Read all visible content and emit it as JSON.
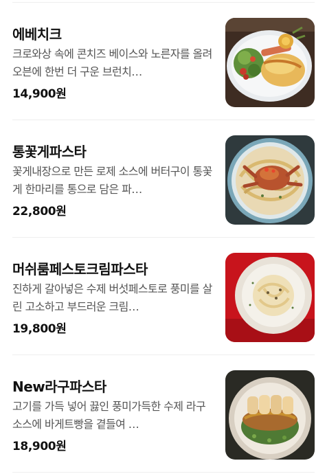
{
  "menu": {
    "items": [
      {
        "name": "에베치크",
        "description": "크로와상 속에 콘치즈 베이스와 노른자를 올려 오븐에 한번 더 구운 브런치…",
        "price": "14,900원",
        "image_icon": "brunch-plate-image"
      },
      {
        "name": "통꽃게파스타",
        "description": "꽃게내장으로 만든 로제 소스에 버터구이 통꽃게 한마리를 통으로 담은 파…",
        "price": "22,800원",
        "image_icon": "crab-pasta-image"
      },
      {
        "name": "머쉬룸페스토크림파스타",
        "description": "진하게 갈아넣은 수제 버섯페스토로 풍미를 살린 고소하고 부드러운 크림…",
        "price": "19,800원",
        "image_icon": "cream-pasta-image"
      },
      {
        "name": "New라구파스타",
        "description": "고기를 가득 넣어 끓인 풍미가득한 수제 라구 소스에 바게트빵을 곁들여 …",
        "price": "18,900원",
        "image_icon": "ragu-pasta-image"
      }
    ]
  }
}
